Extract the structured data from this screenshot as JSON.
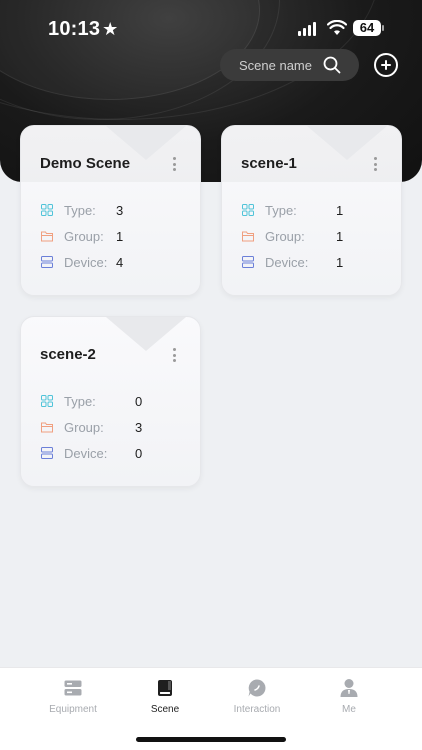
{
  "status": {
    "time": "10:13",
    "battery": "64"
  },
  "search": {
    "placeholder": "Scene name"
  },
  "scenes": [
    {
      "title": "Demo Scene",
      "type_label": "Type:",
      "type": "3",
      "group_label": "Group:",
      "group": "1",
      "device_label": "Device:",
      "device": "4"
    },
    {
      "title": "scene-1",
      "type_label": "Type:",
      "type": "1",
      "group_label": "Group:",
      "group": "1",
      "device_label": "Device:",
      "device": "1"
    },
    {
      "title": "scene-2",
      "type_label": "Type:",
      "type": "0",
      "group_label": "Group:",
      "group": "3",
      "device_label": "Device:",
      "device": "0"
    }
  ],
  "tabs": [
    {
      "label": "Equipment",
      "icon": "equipment-icon"
    },
    {
      "label": "Scene",
      "icon": "scene-icon"
    },
    {
      "label": "Interaction",
      "icon": "chat-icon"
    },
    {
      "label": "Me",
      "icon": "person-icon"
    }
  ],
  "colors": {
    "type_icon": "#4fc3d8",
    "group_icon": "#f0a080",
    "device_icon": "#6b7fd8",
    "active_tab": "#1f1f1f",
    "inactive_tab": "#a8abb0"
  }
}
